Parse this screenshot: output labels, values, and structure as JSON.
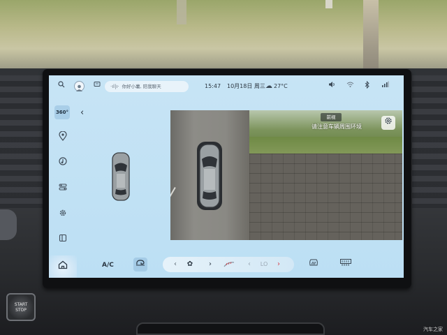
{
  "status_bar": {
    "voice_prompt": "你好小薯, 陪我聊天",
    "time": "15:47",
    "date": "10月18日 周三",
    "temperature": "27°C"
  },
  "sidebar": {
    "surround_view_label": "360°"
  },
  "camera": {
    "view_label": "前视",
    "hint": "请注意车辆周围环境"
  },
  "climate": {
    "ac_label": "A/C",
    "temp_level": "LO"
  },
  "watermark": "汽车之家",
  "start_button": {
    "label_top": "START",
    "label_bottom": "STOP"
  },
  "colors": {
    "screen_bg": "#bcdff4",
    "active_highlight": "#a9cee8",
    "accent_red": "#d9434a"
  }
}
